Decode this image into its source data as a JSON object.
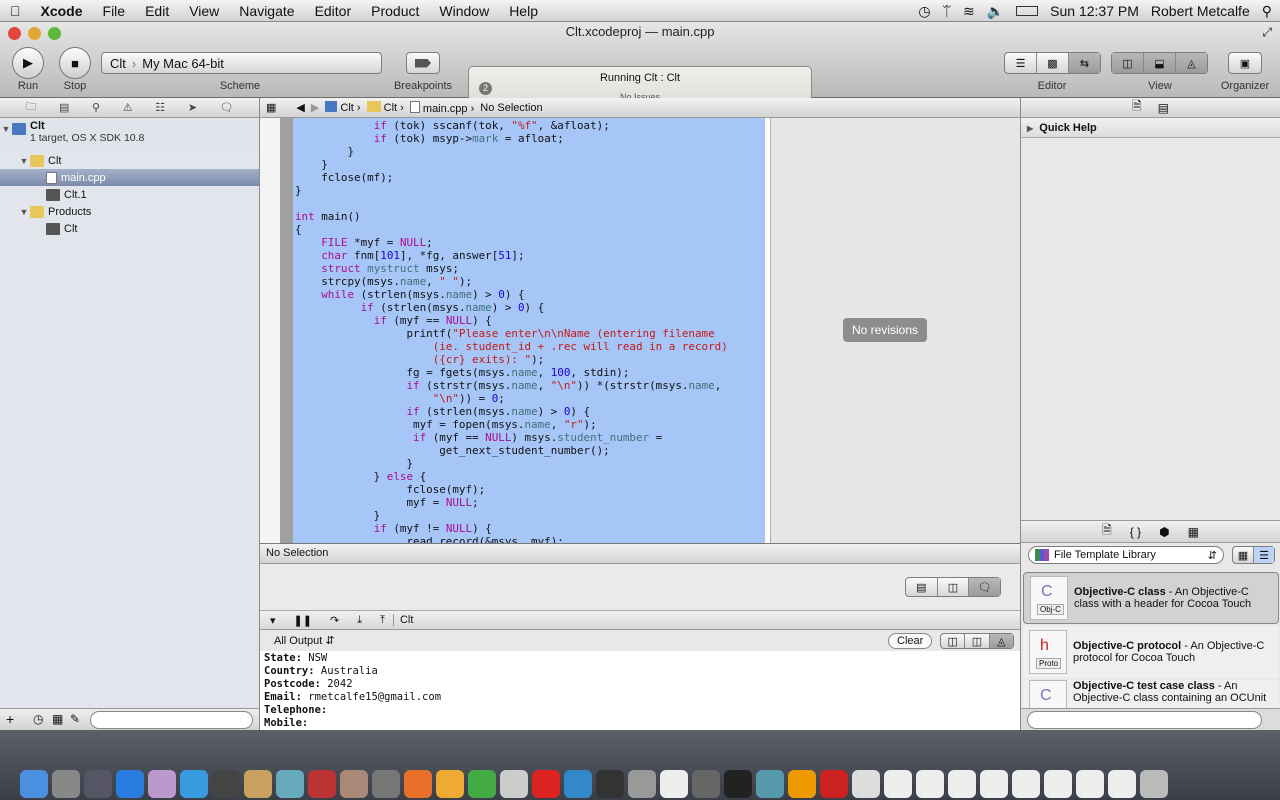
{
  "menubar": {
    "apple": "",
    "app": "Xcode",
    "items": [
      "File",
      "Edit",
      "View",
      "Navigate",
      "Editor",
      "Product",
      "Window",
      "Help"
    ],
    "clock": "Sun 12:37 PM",
    "user": "Robert Metcalfe"
  },
  "window": {
    "title_project": "Clt.xcodeproj",
    "title_sep": "—",
    "title_file": "main.cpp"
  },
  "toolbar": {
    "run": "Run",
    "stop": "Stop",
    "scheme_target": "Clt",
    "scheme_dest": "My Mac 64-bit",
    "scheme": "Scheme",
    "breakpoints": "Breakpoints",
    "editor": "Editor",
    "view": "View",
    "organizer": "Organizer"
  },
  "activity": {
    "badge": "2",
    "status": "Running Clt : Clt",
    "issues": "No Issues"
  },
  "navigator": {
    "project": "Clt",
    "project_sub": "1 target, OS X SDK 10.8",
    "items": [
      {
        "label": "Clt",
        "type": "folder",
        "depth": 1,
        "open": true
      },
      {
        "label": "main.cpp",
        "type": "cpp",
        "depth": 2,
        "selected": true
      },
      {
        "label": "Clt.1",
        "type": "man",
        "depth": 2
      },
      {
        "label": "Products",
        "type": "folder",
        "depth": 1,
        "open": true
      },
      {
        "label": "Clt",
        "type": "exec",
        "depth": 2
      }
    ]
  },
  "jumpbar": {
    "crumbs": [
      "Clt",
      "Clt",
      "main.cpp",
      "No Selection"
    ]
  },
  "code": [
    [
      [
        "            "
      ],
      [
        "if",
        "kw"
      ],
      [
        " (tok) sscanf(tok, "
      ],
      [
        "\"%f\"",
        "str"
      ],
      [
        ", &afloat);"
      ]
    ],
    [
      [
        "            "
      ],
      [
        "if",
        "kw"
      ],
      [
        " (tok) msyp->"
      ],
      [
        "mark",
        "mem"
      ],
      [
        " = afloat;"
      ]
    ],
    [
      [
        "        }"
      ]
    ],
    [
      [
        "    }"
      ]
    ],
    [
      [
        "    fclose(mf);"
      ]
    ],
    [
      [
        "}"
      ]
    ],
    [
      [
        ""
      ]
    ],
    [
      [
        "int",
        "kw"
      ],
      [
        " main()"
      ]
    ],
    [
      [
        "{"
      ]
    ],
    [
      [
        "    "
      ],
      [
        "FILE",
        "kw"
      ],
      [
        " *myf = "
      ],
      [
        "NULL",
        "kw"
      ],
      [
        ";"
      ]
    ],
    [
      [
        "    "
      ],
      [
        "char",
        "kw"
      ],
      [
        " fnm["
      ],
      [
        "101",
        "num"
      ],
      [
        "], *fg, answer["
      ],
      [
        "51",
        "num"
      ],
      [
        "];"
      ]
    ],
    [
      [
        "    "
      ],
      [
        "struct",
        "kw"
      ],
      [
        " "
      ],
      [
        "mystruct",
        "mem"
      ],
      [
        " msys;"
      ]
    ],
    [
      [
        "    strcpy(msys."
      ],
      [
        "name",
        "mem"
      ],
      [
        ", "
      ],
      [
        "\" \"",
        "str"
      ],
      [
        ");"
      ]
    ],
    [
      [
        "    "
      ],
      [
        "while",
        "kw"
      ],
      [
        " (strlen(msys."
      ],
      [
        "name",
        "mem"
      ],
      [
        ") > "
      ],
      [
        "0",
        "num"
      ],
      [
        ") {"
      ]
    ],
    [
      [
        "          "
      ],
      [
        "if",
        "kw"
      ],
      [
        " (strlen(msys."
      ],
      [
        "name",
        "mem"
      ],
      [
        ") > "
      ],
      [
        "0",
        "num"
      ],
      [
        ") {"
      ]
    ],
    [
      [
        "            "
      ],
      [
        "if",
        "kw"
      ],
      [
        " (myf == "
      ],
      [
        "NULL",
        "kw"
      ],
      [
        ") {"
      ]
    ],
    [
      [
        "                 printf("
      ],
      [
        "\"Please enter\\n\\nName (entering filename",
        "str"
      ]
    ],
    [
      [
        "                     "
      ],
      [
        "(ie. student_id + .rec will read in a record)",
        "str"
      ]
    ],
    [
      [
        "                     "
      ],
      [
        "({cr} exits): \"",
        "str"
      ],
      [
        ");"
      ]
    ],
    [
      [
        "                 fg = fgets(msys."
      ],
      [
        "name",
        "mem"
      ],
      [
        ", "
      ],
      [
        "100",
        "num"
      ],
      [
        ", stdin);"
      ]
    ],
    [
      [
        "                 "
      ],
      [
        "if",
        "kw"
      ],
      [
        " (strstr(msys."
      ],
      [
        "name",
        "mem"
      ],
      [
        ", "
      ],
      [
        "\"\\n\"",
        "str"
      ],
      [
        ")) *(strstr(msys."
      ],
      [
        "name",
        "mem"
      ],
      [
        ","
      ]
    ],
    [
      [
        "                     "
      ],
      [
        "\"\\n\"",
        "str"
      ],
      [
        ")) = "
      ],
      [
        "0",
        "num"
      ],
      [
        ";"
      ]
    ],
    [
      [
        "                 "
      ],
      [
        "if",
        "kw"
      ],
      [
        " (strlen(msys."
      ],
      [
        "name",
        "mem"
      ],
      [
        ") > "
      ],
      [
        "0",
        "num"
      ],
      [
        ") {"
      ]
    ],
    [
      [
        "                  myf = fopen(msys."
      ],
      [
        "name",
        "mem"
      ],
      [
        ", "
      ],
      [
        "\"r\"",
        "str"
      ],
      [
        ");"
      ]
    ],
    [
      [
        "                  "
      ],
      [
        "if",
        "kw"
      ],
      [
        " (myf == "
      ],
      [
        "NULL",
        "kw"
      ],
      [
        ") msys."
      ],
      [
        "student_number",
        "mem"
      ],
      [
        " ="
      ]
    ],
    [
      [
        "                      get_next_student_number();"
      ]
    ],
    [
      [
        "                 }"
      ]
    ],
    [
      [
        "            } "
      ],
      [
        "else",
        "kw"
      ],
      [
        " {"
      ]
    ],
    [
      [
        "                 fclose(myf);"
      ]
    ],
    [
      [
        "                 myf = "
      ],
      [
        "NULL",
        "kw"
      ],
      [
        ";"
      ]
    ],
    [
      [
        "            }"
      ]
    ],
    [
      [
        "            "
      ],
      [
        "if",
        "kw"
      ],
      [
        " (myf != "
      ],
      [
        "NULL",
        "kw"
      ],
      [
        ") {"
      ]
    ],
    [
      [
        "                 read_record(&msys, myf);"
      ]
    ]
  ],
  "revisions": {
    "empty": "No revisions"
  },
  "debug": {
    "selection": "No Selection",
    "process": "Clt",
    "output_filter": "All Output",
    "clear": "Clear",
    "console": [
      [
        "State:",
        " NSW"
      ],
      [
        "Country:",
        " Australia"
      ],
      [
        "Postcode:",
        " 2042"
      ],
      [
        "Email:",
        " rmetcalfe15@gmail.com"
      ],
      [
        "Telephone:",
        ""
      ],
      [
        "Mobile:",
        ""
      ]
    ]
  },
  "utilities": {
    "quick_help": "Quick Help",
    "library": "File Template Library",
    "templates": [
      {
        "title": "Objective-C class",
        "desc": " - An Objective-C class with a header for Cocoa Touch",
        "badge": "Obj-C",
        "letter": "C",
        "selected": true
      },
      {
        "title": "Objective-C protocol",
        "desc": " - An Objective-C protocol for Cocoa Touch",
        "badge": "Proto",
        "letter": "h"
      },
      {
        "title": "Objective-C test case class",
        "desc": " - An Objective-C class containing an OCUnit",
        "badge": "",
        "letter": "C"
      }
    ]
  },
  "colors": {
    "selection": "#a7c6f8",
    "keyword": "#aa0d91",
    "string": "#c41a16",
    "number": "#1c00cf",
    "member": "#3f7078"
  },
  "dock": {
    "icons": [
      "finder",
      "launchpad",
      "system-monitor",
      "app-store",
      "preview",
      "safari",
      "facetime",
      "contacts",
      "itunes",
      "photo-booth",
      "iphoto",
      "image-capture",
      "firefox",
      "wunderlist",
      "chrome",
      "xcode-instruments",
      "opera",
      "xcode",
      "terminal-alt",
      "help",
      "system-info",
      "brackets",
      "terminal",
      "photo-app",
      "vlc",
      "acrobat",
      "cpp-file",
      "document",
      "document",
      "document",
      "document",
      "document",
      "document",
      "document",
      "document",
      "trash"
    ]
  }
}
